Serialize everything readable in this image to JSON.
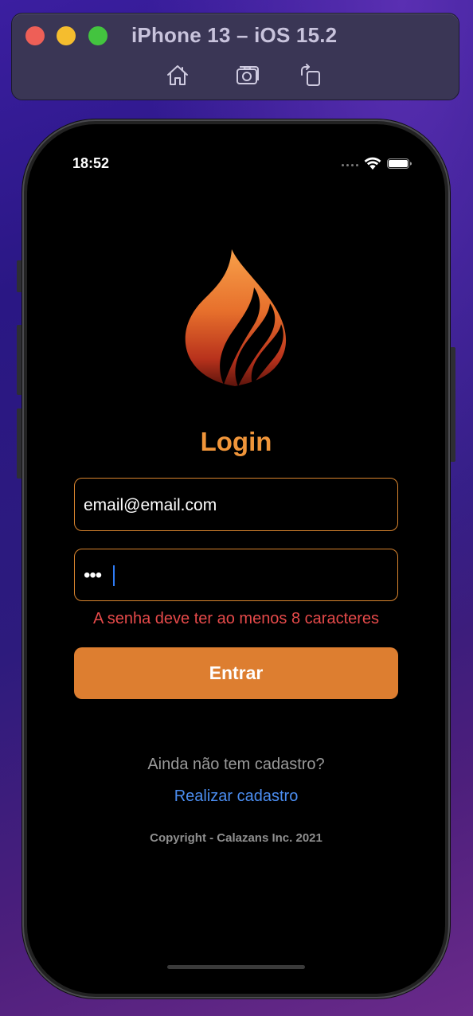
{
  "simulator": {
    "title": "iPhone 13 – iOS 15.2",
    "toolbar_icons": [
      "home-icon",
      "screenshot-icon",
      "rotate-icon"
    ]
  },
  "status_bar": {
    "time": "18:52",
    "icons": [
      "signal-icon",
      "wifi-icon",
      "battery-icon"
    ]
  },
  "app": {
    "logo_icon": "flame-logo",
    "title": "Login",
    "email": {
      "value": "email@email.com"
    },
    "password": {
      "masked_value": "•••"
    },
    "error_message": "A senha deve ter ao menos 8 caracteres",
    "submit_label": "Entrar",
    "no_account_text": "Ainda não tem cadastro?",
    "register_link": "Realizar cadastro",
    "copyright": "Copyright - Calazans Inc. 2021"
  },
  "colors": {
    "accent": "#dd7e30",
    "title": "#f0953a",
    "error": "#e64a4a",
    "link": "#4b8df0",
    "background": "#000000"
  }
}
